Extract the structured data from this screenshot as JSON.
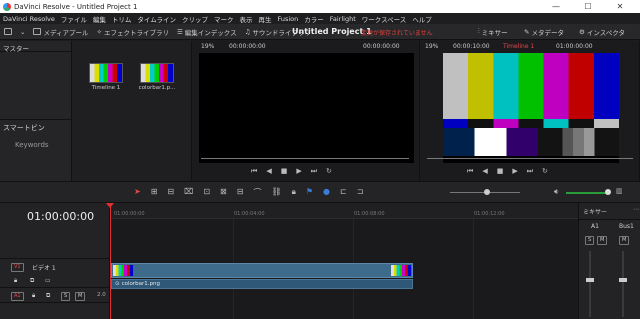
{
  "window": {
    "title": "DaVinci Resolve - Untitled Project 1",
    "min": "—",
    "max": "☐",
    "close": "✕"
  },
  "menu": [
    "DaVinci Resolve",
    "ファイル",
    "編集",
    "トリム",
    "タイムライン",
    "クリップ",
    "マーク",
    "表示",
    "再生",
    "Fusion",
    "カラー",
    "Fairlight",
    "ワークスペース",
    "ヘルプ"
  ],
  "toolbar": {
    "media_pool": "メディアプール",
    "effects": "エフェクトライブラリ",
    "edit_index": "編集インデックス",
    "sound_library": "サウンドライブラリ",
    "project_title": "Untitled Project 1",
    "unsaved": "変更が保存されていません",
    "mixer": "ミキサー",
    "metadata": "メタデータ",
    "inspector": "インスペクタ"
  },
  "left_panel": {
    "master": "マスター",
    "smart_bin": "スマートビン",
    "keywords": "Keywords"
  },
  "bin": {
    "clips": [
      {
        "name": "Timeline 1"
      },
      {
        "name": "colorbar1.p..."
      }
    ]
  },
  "source_viewer": {
    "zoom": "19%",
    "tc_left": "00:00:00:00",
    "tc_right": "00:00:00:00"
  },
  "timeline_viewer": {
    "zoom": "19%",
    "tc_left": "00:00:10:00",
    "timeline_name": "Timeline 1",
    "tc_right": "01:00:00:00"
  },
  "timeline": {
    "current_tc": "01:00:00:00",
    "ruler": [
      "01:00:00:00",
      "01:00:04:00",
      "01:00:08:00",
      "01:00:12:00"
    ],
    "video_track": {
      "id": "V1",
      "name": "ビデオ 1"
    },
    "audio_track": {
      "id": "A1",
      "level": "2.0"
    },
    "clip_name": "colorbar1.png",
    "solo": "S",
    "mute": "M"
  },
  "mixer": {
    "title": "ミキサー",
    "ch1": "A1",
    "ch2": "Bus1"
  },
  "colors": {
    "playhead": "#e03030",
    "accent_red": "#e04a4a",
    "clip_blue": "#3e6a8c"
  }
}
